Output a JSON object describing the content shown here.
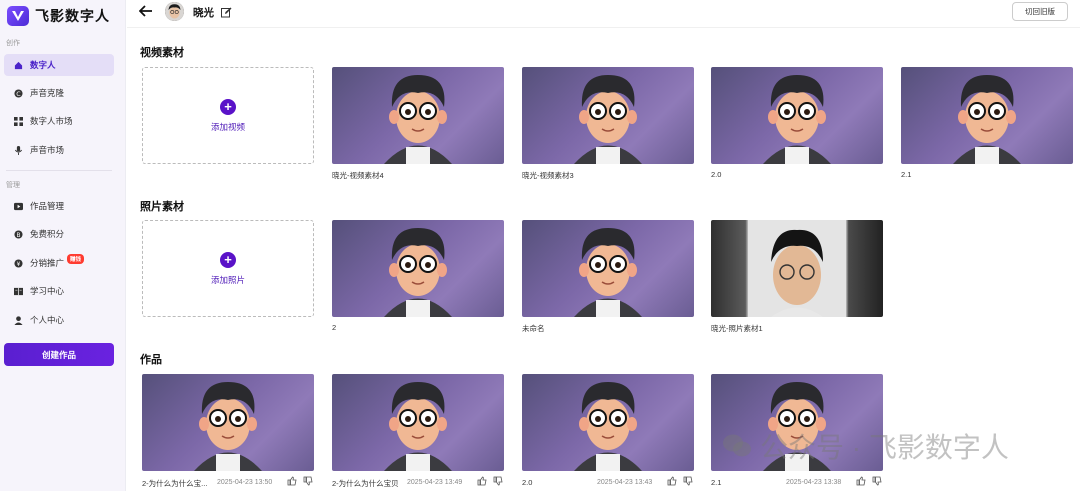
{
  "app": {
    "name": "飞影数字人"
  },
  "sidebar": {
    "create_section": "创作",
    "manage_section": "管理",
    "create_items": [
      {
        "label": "数字人",
        "icon": "home-icon",
        "active": true
      },
      {
        "label": "声音克隆",
        "icon": "voice-clone-icon"
      },
      {
        "label": "数字人市场",
        "icon": "grid-icon"
      },
      {
        "label": "声音市场",
        "icon": "microphone-icon"
      }
    ],
    "manage_items": [
      {
        "label": "作品管理",
        "icon": "play-icon"
      },
      {
        "label": "免费积分",
        "icon": "coin-icon"
      },
      {
        "label": "分销推广",
        "icon": "promote-icon",
        "badge": "赚钱"
      },
      {
        "label": "学习中心",
        "icon": "book-icon"
      },
      {
        "label": "个人中心",
        "icon": "user-icon"
      }
    ],
    "create_button": "创建作品"
  },
  "header": {
    "user_name": "晓光",
    "switch_label": "切回旧版"
  },
  "video_section": {
    "title": "视频素材",
    "add_label": "添加视频",
    "items": [
      "晓光-视频素材4",
      "晓光-视频素材3",
      "2.0",
      "2.1"
    ]
  },
  "photo_section": {
    "title": "照片素材",
    "add_label": "添加照片",
    "items": [
      "2",
      "未命名",
      "晓光-照片素材1"
    ]
  },
  "works_section": {
    "title": "作品",
    "items": [
      {
        "name": "2-为什么为什么宝...",
        "date": "2025-04-23 13:50"
      },
      {
        "name": "2-为什么为什么宝贝",
        "date": "2025-04-23 13:49"
      },
      {
        "name": "2.0",
        "date": "2025-04-23 13:43"
      },
      {
        "name": "2.1",
        "date": "2025-04-23 13:38"
      }
    ]
  },
  "watermark": {
    "text": "公众号 · 飞影数字人"
  },
  "colors": {
    "accent": "#5a12c8",
    "active_bg": "#e4def7",
    "badge": "#ff3b30"
  }
}
